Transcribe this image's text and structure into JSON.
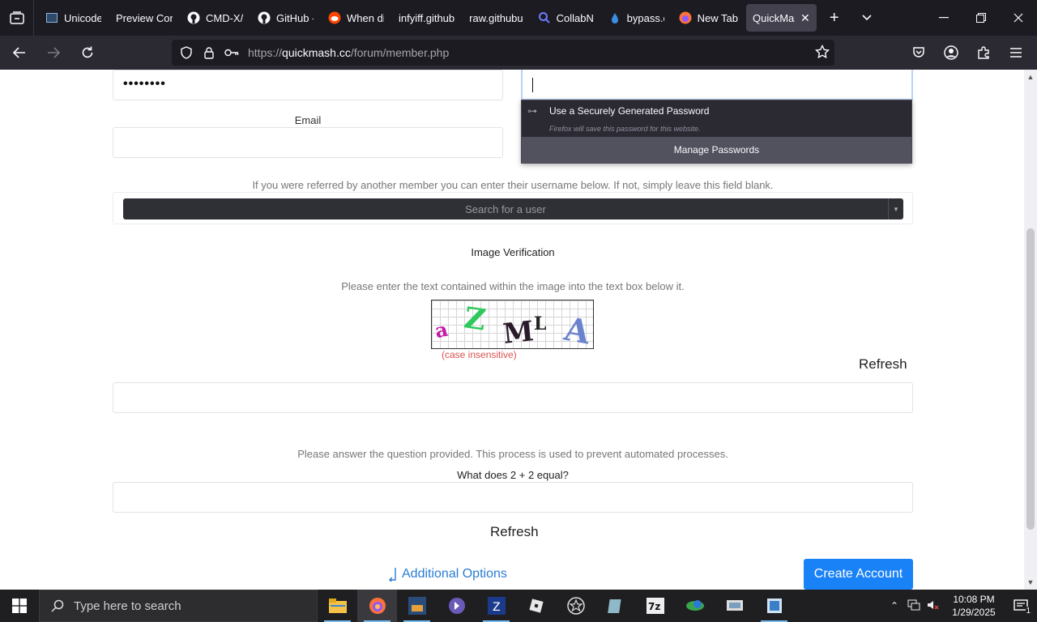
{
  "browser": {
    "tabs": [
      {
        "label": "Unicode",
        "icon": "terminal-favicon-icon"
      },
      {
        "label": "Preview Con",
        "icon": ""
      },
      {
        "label": "CMD-X/",
        "icon": "github-icon"
      },
      {
        "label": "GitHub -",
        "icon": "github-icon"
      },
      {
        "label": "When di",
        "icon": "reddit-icon"
      },
      {
        "label": "infyiff.github",
        "icon": ""
      },
      {
        "label": "raw.githubu",
        "icon": ""
      },
      {
        "label": "CollabNe",
        "icon": "search-favicon-icon"
      },
      {
        "label": "bypass.c",
        "icon": "drop-favicon-icon"
      },
      {
        "label": "New Tab",
        "icon": "firefox-icon"
      },
      {
        "label": "QuickMas",
        "icon": "",
        "active": true
      }
    ],
    "url_prefix": "https://",
    "url_host": "quickmash.cc",
    "url_path": "/forum/member.php"
  },
  "form": {
    "password_mask": "••••••••",
    "email_label": "Email",
    "referral_text": "If you were referred by another member you can enter their username below. If not, simply leave this field blank.",
    "search_user_placeholder": "Search for a user",
    "image_verification_title": "Image Verification",
    "image_verification_hint": "Please enter the text contained within the image into the text box below it.",
    "captcha_chars": [
      "a",
      "Z",
      "M",
      "L",
      "A"
    ],
    "case_note": "(case insensitive)",
    "refresh_label": "Refresh",
    "question_hint": "Please answer the question provided. This process is used to prevent automated processes.",
    "question": "What does 2 + 2 equal?",
    "additional_options": "Additional Options",
    "create_account": "Create Account"
  },
  "password_popup": {
    "title": "Use a Securely Generated Password",
    "subtitle": "Firefox will save this password for this website.",
    "manage": "Manage Passwords"
  },
  "taskbar": {
    "search_placeholder": "Type here to search",
    "time": "10:08 PM",
    "date": "1/29/2025",
    "notification_count": "1",
    "apps": [
      "file-explorer-icon",
      "firefox-icon",
      "game-app-icon",
      "app-icon",
      "app-icon",
      "roblox-icon",
      "star-app-icon",
      "app-icon",
      "7zip-icon",
      "app-icon",
      "app-icon",
      "app-icon"
    ]
  },
  "colors": {
    "accent": "#1a82f7",
    "link": "#2a7cd3",
    "case_note": "#d9534f"
  }
}
